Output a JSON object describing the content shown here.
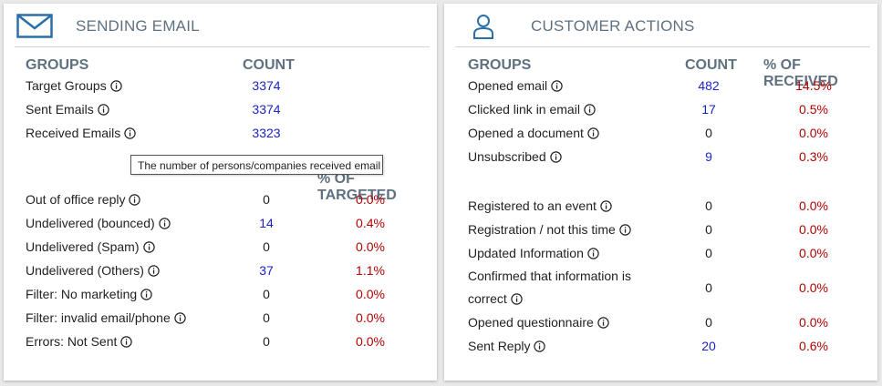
{
  "sending": {
    "title": "SENDING EMAIL",
    "icon": "envelope-icon",
    "col_groups": "GROUPS",
    "col_count": "COUNT",
    "col_pct": "% OF TARGETED",
    "top_rows": [
      {
        "label": "Target Groups",
        "count": "3374"
      },
      {
        "label": "Sent Emails",
        "count": "3374"
      },
      {
        "label": "Received Emails",
        "count": "3323"
      }
    ],
    "tooltip": "The number of persons/companies received email",
    "rows": [
      {
        "label": "Out of office reply",
        "count": "0",
        "pct": "0.0%"
      },
      {
        "label": "Undelivered (bounced)",
        "count": "14",
        "pct": "0.4%"
      },
      {
        "label": "Undelivered (Spam)",
        "count": "0",
        "pct": "0.0%"
      },
      {
        "label": "Undelivered (Others)",
        "count": "37",
        "pct": "1.1%"
      },
      {
        "label": "Filter: No marketing",
        "count": "0",
        "pct": "0.0%"
      },
      {
        "label": "Filter: invalid email/phone",
        "count": "0",
        "pct": "0.0%"
      },
      {
        "label": "Errors: Not Sent",
        "count": "0",
        "pct": "0.0%"
      }
    ]
  },
  "customer": {
    "title": "CUSTOMER ACTIONS",
    "icon": "user-icon",
    "col_groups": "GROUPS",
    "col_count": "COUNT",
    "col_pct": "% OF RECEIVED",
    "rows_a": [
      {
        "label": "Opened email",
        "count": "482",
        "pct": "14.5%"
      },
      {
        "label": "Clicked link in email",
        "count": "17",
        "pct": "0.5%"
      },
      {
        "label": "Opened a document",
        "count": "0",
        "pct": "0.0%"
      },
      {
        "label": "Unsubscribed",
        "count": "9",
        "pct": "0.3%"
      }
    ],
    "rows_b": [
      {
        "label": "Registered to an event",
        "count": "0",
        "pct": "0.0%"
      },
      {
        "label": "Registration / not this time",
        "count": "0",
        "pct": "0.0%"
      },
      {
        "label": "Updated Information",
        "count": "0",
        "pct": "0.0%"
      },
      {
        "label_line1": "Confirmed that information is",
        "label_line2": "correct",
        "count": "0",
        "pct": "0.0%"
      },
      {
        "label": "Opened questionnaire",
        "count": "0",
        "pct": "0.0%"
      },
      {
        "label": "Sent Reply",
        "count": "20",
        "pct": "0.6%"
      }
    ]
  },
  "colors": {
    "header": "#5f7181",
    "link_blue": "#1a23c7",
    "pct_red": "#b40000",
    "icon_blue": "#2a6fa8"
  }
}
